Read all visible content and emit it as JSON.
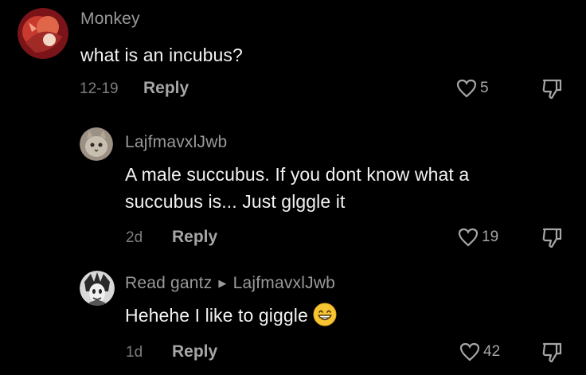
{
  "colors": {
    "background": "#000000",
    "text": "#f2f2f2",
    "muted": "#9a9a9a"
  },
  "comments": [
    {
      "username": "Monkey",
      "text": "what is an incubus?",
      "date": "12-19",
      "reply_label": "Reply",
      "likes": "5",
      "avatar_icon": "monkey-avatar"
    },
    {
      "username": "LajfmavxlJwb",
      "text_line1": "A male succubus. If you dont know what a",
      "text_line2": "succubus is... Just glggle it",
      "date": "2d",
      "reply_label": "Reply",
      "likes": "19",
      "avatar_icon": "cat-avatar"
    },
    {
      "username": "Read gantz",
      "reply_to": "LajfmavxlJwb",
      "text": "Hehehe I like to giggle",
      "emoji": "grinning-face",
      "date": "1d",
      "reply_label": "Reply",
      "likes": "42",
      "avatar_icon": "anime-avatar"
    }
  ]
}
